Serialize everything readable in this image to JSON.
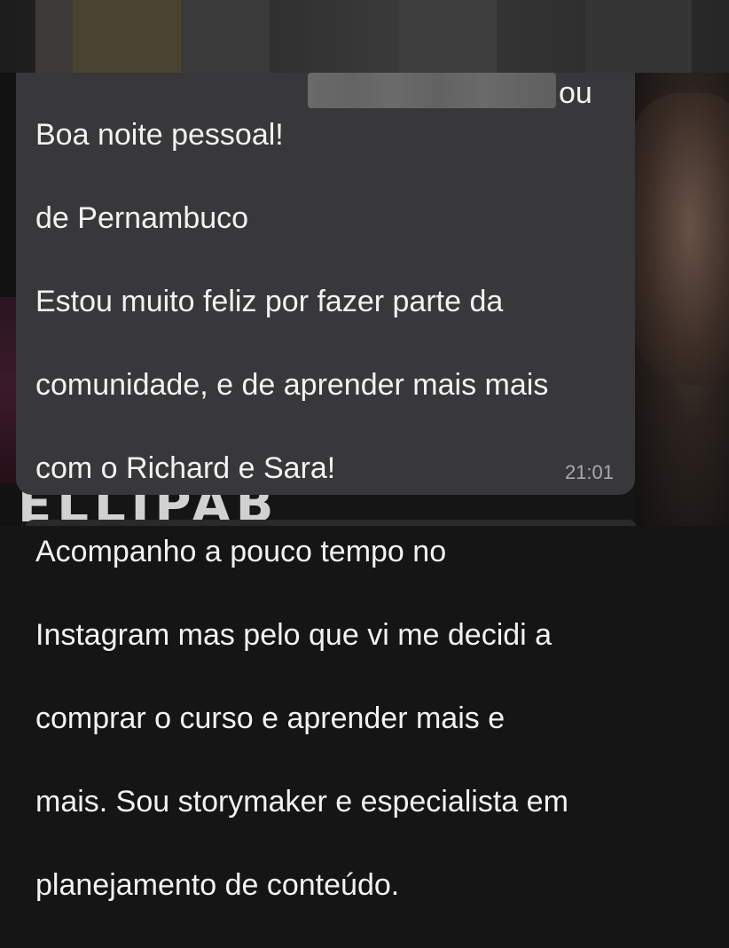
{
  "message": {
    "lines": [
      "Boa noite pessoal!",
      "de Pernambuco",
      "Estou muito feliz por fazer parte da",
      "comunidade, e de aprender mais mais",
      "com o Richard e Sara!",
      "Acompanho a pouco tempo no",
      "Instagram mas pelo que vi me decidi a",
      "comprar o curso e aprender mais e",
      "mais. Sou storymaker e especialista em",
      "planejamento de conteúdo."
    ],
    "redaction_tail": "ou",
    "timestamp": "21:01"
  },
  "background": {
    "bottom_text": "ELLIPAB"
  },
  "colors": {
    "bubble": "#38383a",
    "text": "#f2f2f2",
    "timestamp": "#a9a9ad",
    "background": "#151515"
  }
}
